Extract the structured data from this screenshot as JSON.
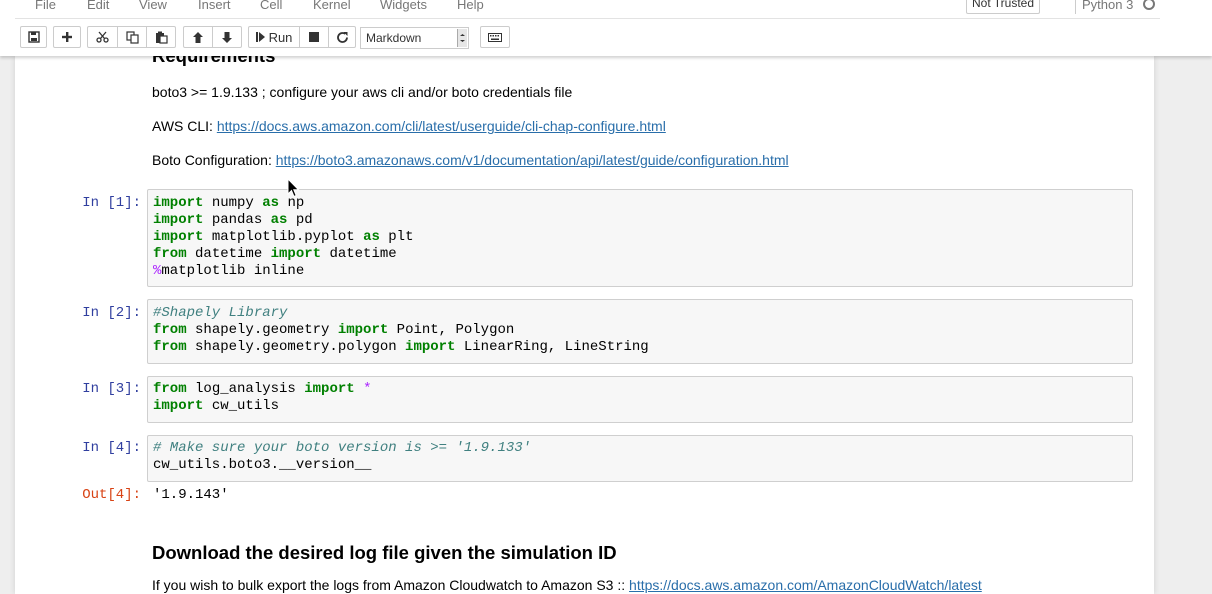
{
  "menubar": {
    "items": [
      "File",
      "Edit",
      "View",
      "Insert",
      "Cell",
      "Kernel",
      "Widgets",
      "Help"
    ],
    "trusted_label": "Not Trusted",
    "kernel_name": "Python 3"
  },
  "toolbar": {
    "run_label": "Run",
    "cell_type_value": "Markdown",
    "icons": [
      "save-icon",
      "plus-icon",
      "cut-icon",
      "copy-icon",
      "paste-icon",
      "arrow-up-icon",
      "arrow-down-icon",
      "step-forward-icon",
      "stop-icon",
      "restart-icon",
      "keyboard-icon"
    ]
  },
  "markdown": {
    "requirements_heading": "Requirements",
    "boto_req": "boto3 >= 1.9.133 ; configure your aws cli and/or boto credentials file",
    "aws_cli_label": "AWS CLI: ",
    "aws_cli_link": "https://docs.aws.amazon.com/cli/latest/userguide/cli-chap-configure.html",
    "boto_config_label": "Boto Configuration: ",
    "boto_config_link": "https://boto3.amazonaws.com/v1/documentation/api/latest/guide/configuration.html",
    "download_heading": "Download the desired log file given the simulation ID",
    "bulk_export_text": "If you wish to bulk export the logs from Amazon Cloudwatch to Amazon S3 :: ",
    "bulk_export_link": "https://docs.aws.amazon.com/AmazonCloudWatch/latest"
  },
  "cells": [
    {
      "prompt": "In [1]:",
      "lines": [
        [
          {
            "t": "import",
            "c": "kw"
          },
          {
            "t": " numpy "
          },
          {
            "t": "as",
            "c": "kw"
          },
          {
            "t": " np"
          }
        ],
        [
          {
            "t": "import",
            "c": "kw"
          },
          {
            "t": " pandas "
          },
          {
            "t": "as",
            "c": "kw"
          },
          {
            "t": " pd"
          }
        ],
        [
          {
            "t": "import",
            "c": "kw"
          },
          {
            "t": " matplotlib.pyplot "
          },
          {
            "t": "as",
            "c": "kw"
          },
          {
            "t": " plt"
          }
        ],
        [
          {
            "t": "from",
            "c": "kw"
          },
          {
            "t": " datetime "
          },
          {
            "t": "import",
            "c": "kw"
          },
          {
            "t": " datetime"
          }
        ],
        [
          {
            "t": "%",
            "c": "mg"
          },
          {
            "t": "matplotlib inline"
          }
        ]
      ]
    },
    {
      "prompt": "In [2]:",
      "lines": [
        [
          {
            "t": "#Shapely Library",
            "c": "cm"
          }
        ],
        [
          {
            "t": "from",
            "c": "kw"
          },
          {
            "t": " shapely.geometry "
          },
          {
            "t": "import",
            "c": "kw"
          },
          {
            "t": " Point, Polygon"
          }
        ],
        [
          {
            "t": "from",
            "c": "kw"
          },
          {
            "t": " shapely.geometry.polygon "
          },
          {
            "t": "import",
            "c": "kw"
          },
          {
            "t": " LinearRing, LineString"
          }
        ]
      ]
    },
    {
      "prompt": "In [3]:",
      "lines": [
        [
          {
            "t": "from",
            "c": "kw"
          },
          {
            "t": " log_analysis "
          },
          {
            "t": "import",
            "c": "kw"
          },
          {
            "t": " "
          },
          {
            "t": "*",
            "c": "mg"
          }
        ],
        [
          {
            "t": "import",
            "c": "kw"
          },
          {
            "t": " cw_utils"
          }
        ]
      ]
    },
    {
      "prompt": "In [4]:",
      "lines": [
        [
          {
            "t": "# Make sure your boto version is >= '1.9.133'",
            "c": "cm"
          }
        ],
        [
          {
            "t": "cw_utils.boto3.__version__"
          }
        ]
      ],
      "out_prompt": "Out[4]:",
      "output": "'1.9.143'"
    }
  ]
}
